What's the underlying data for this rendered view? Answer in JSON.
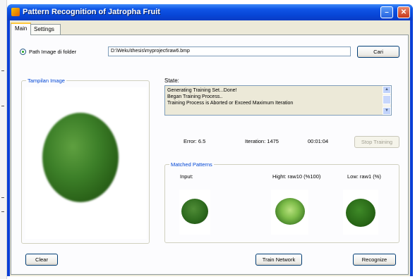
{
  "window": {
    "title": "Pattern Recognition of Jatropha Fruit"
  },
  "tabs": [
    {
      "label": "Main"
    },
    {
      "label": "Settings"
    }
  ],
  "source": {
    "radio_label": "Path Image di folder",
    "path_value": "D:\\Weku\\thesis\\myproject\\raw6.bmp",
    "browse_label": "Cari"
  },
  "image_group": {
    "legend": "Tampilan Image"
  },
  "state": {
    "label": "State:",
    "lines": [
      "Generating Training Set...Done!",
      "Began Training Process..",
      "Training Process is Aborted or Exceed Maximum Iteration"
    ]
  },
  "training": {
    "error_text": "Error: 6.5",
    "iteration_text": "Iteration: 1475",
    "time_text": "00:01:04",
    "stop_label": "Stop Training"
  },
  "matched": {
    "legend": "Matched Patterns",
    "input_label": "Input:",
    "high_label": "Hight: raw10 (%100)",
    "low_label": "Low: raw1 (%)"
  },
  "buttons": {
    "clear_label": "Clear",
    "train_label": "Train Network",
    "recognize_label": "Recognize"
  },
  "titlebar_controls": {
    "minimize": "–",
    "close": "✕"
  },
  "colors": {
    "titlebar": "#0745d6",
    "legend": "#0046d5",
    "panel": "#ece9d8"
  },
  "icons": {
    "app": "app-icon",
    "scroll_up": "scroll-up-icon",
    "scroll_down": "scroll-down-icon"
  }
}
